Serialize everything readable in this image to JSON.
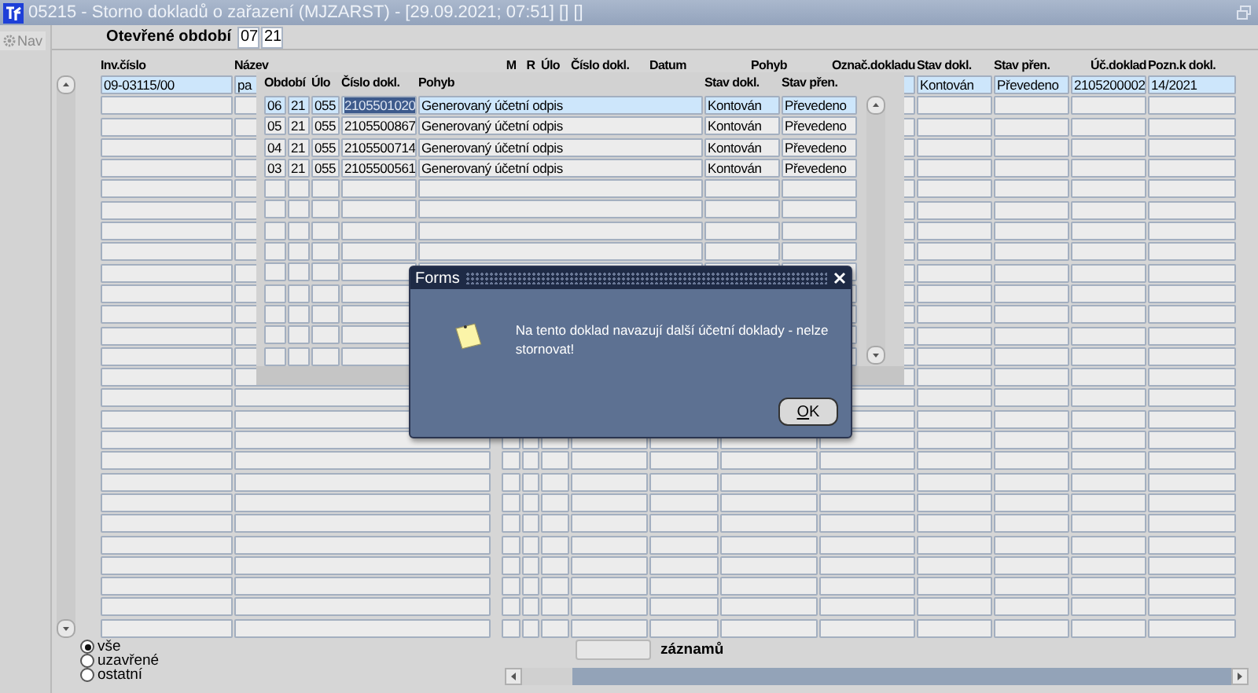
{
  "window": {
    "title": "05215 - Storno dokladů o zařazení (MJZARST) - [29.09.2021; 07:51] [] []"
  },
  "sidebar": {
    "nav_button": "Nav"
  },
  "period": {
    "label": "Otevřené období",
    "month": "07",
    "year": "21"
  },
  "main_table": {
    "headers": {
      "inv": "Inv.číslo",
      "nazev": "Název",
      "m": "M",
      "r": "R",
      "ulo": "Úlo",
      "cislo": "Číslo dokl.",
      "datum": "Datum",
      "pohyb": "Pohyb",
      "oznac": "Označ.dokladu",
      "stav_dokl": "Stav dokl.",
      "stav_pren": "Stav přen.",
      "uc_doklad": "Úč.doklad",
      "pozn": "Pozn.k dokl."
    },
    "rows": [
      {
        "inv": "09-03115/00",
        "nazev": "pa",
        "stav_dokl": "Kontován",
        "stav_pren": "Převedeno",
        "uc_doklad": "2105200002",
        "pozn": "14/2021",
        "selected": true
      }
    ]
  },
  "list_panel": {
    "headers": {
      "period": "Období",
      "ulo": "Úlo",
      "cislo": "Číslo dokl.",
      "pohyb": "Pohyb",
      "stav_dokl": "Stav dokl.",
      "stav_pren": "Stav přen."
    },
    "rows": [
      {
        "month": "06",
        "year": "21",
        "ulo": "055",
        "cislo": "2105501020",
        "pohyb": "Generovaný účetní odpis",
        "stav_dokl": "Kontován",
        "stav_pren": "Převedeno",
        "selected": true,
        "number_highlighted": true
      },
      {
        "month": "05",
        "year": "21",
        "ulo": "055",
        "cislo": "2105500867",
        "pohyb": "Generovaný účetní odpis",
        "stav_dokl": "Kontován",
        "stav_pren": "Převedeno",
        "selected": false,
        "number_highlighted": false
      },
      {
        "month": "04",
        "year": "21",
        "ulo": "055",
        "cislo": "2105500714",
        "pohyb": "Generovaný účetní odpis",
        "stav_dokl": "Kontován",
        "stav_pren": "Převedeno",
        "selected": false,
        "number_highlighted": false
      },
      {
        "month": "03",
        "year": "21",
        "ulo": "055",
        "cislo": "2105500561",
        "pohyb": "Generovaný účetní odpis",
        "stav_dokl": "Kontován",
        "stav_pren": "Převedeno",
        "selected": false,
        "number_highlighted": false
      }
    ]
  },
  "filter": {
    "options": [
      {
        "label": "vše",
        "selected": true
      },
      {
        "label": "uzavřené",
        "selected": false
      },
      {
        "label": "ostatní",
        "selected": false
      }
    ]
  },
  "records": {
    "label": "záznamů"
  },
  "dialog": {
    "title": "Forms",
    "message": "Na tento doklad navazují další účetní doklady - nelze stornovat!",
    "button": "OK"
  }
}
